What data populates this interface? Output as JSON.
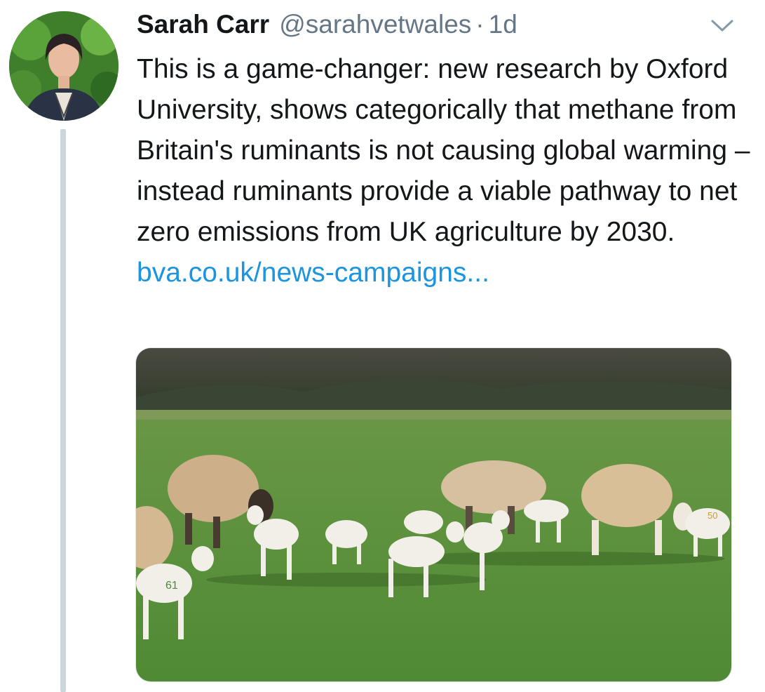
{
  "tweet": {
    "author_name": "Sarah Carr",
    "author_handle": "@sarahvetwales",
    "separator": "·",
    "timestamp": "1d",
    "text": "This is a game-changer: new research by Oxford University, shows categorically that methane from Britain's ruminants is not causing global warming – instead ruminants provide a viable pathway to net zero emissions from UK agriculture by 2030.",
    "link_text": "bva.co.uk/news-campaigns...",
    "image": {
      "description_icon": "photo-sheep-and-lambs",
      "ear_tag_label": "61",
      "sheep_tag_label": "50"
    }
  },
  "colors": {
    "link": "#1b95e0",
    "muted": "#657786",
    "thread_line": "#ccd6dd"
  }
}
